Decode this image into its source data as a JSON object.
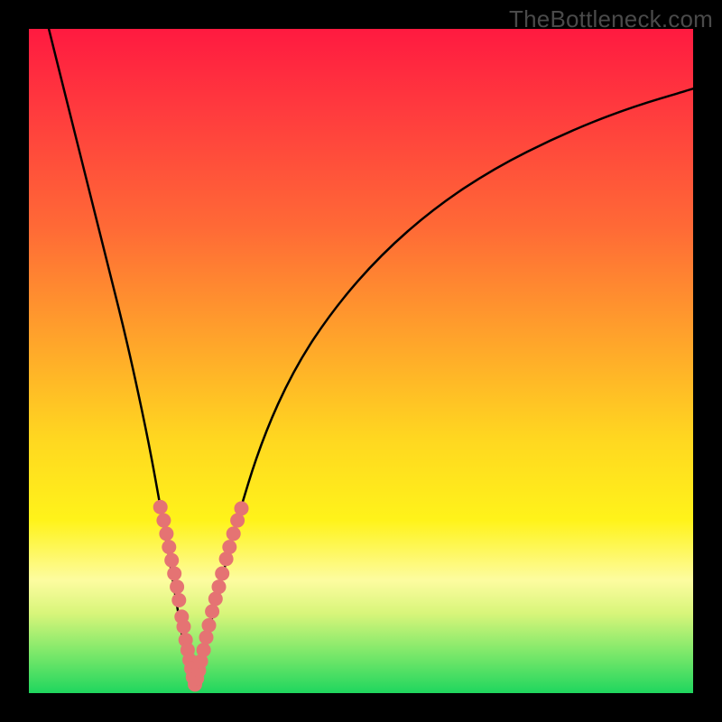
{
  "watermark": "TheBottleneck.com",
  "colors": {
    "frame": "#000000",
    "gradient_top": "#ff1a40",
    "gradient_mid1": "#ff6a36",
    "gradient_mid2": "#ffd820",
    "gradient_mid3": "#fdfca0",
    "gradient_bottom": "#1fd65e",
    "curve": "#000000",
    "marker": "#e57373"
  },
  "chart_data": {
    "type": "line",
    "title": "",
    "xlabel": "",
    "ylabel": "",
    "xlim": [
      0,
      100
    ],
    "ylim": [
      0,
      100
    ],
    "series": [
      {
        "name": "bottleneck-curve",
        "x": [
          3,
          6,
          9,
          12,
          15,
          18,
          20,
          22,
          23.5,
          25,
          26,
          28,
          31,
          35,
          40,
          46,
          53,
          61,
          70,
          80,
          90,
          100
        ],
        "y": [
          100,
          88,
          76,
          64,
          52,
          38,
          27,
          15,
          6,
          0,
          5,
          13,
          25,
          38,
          49,
          58,
          66,
          73,
          79,
          84,
          88,
          91
        ]
      }
    ],
    "markers": {
      "name": "highlighted-points",
      "note": "Dense salmon markers clustered near the V dip on both branches (approx y in 3–27 range).",
      "points": [
        {
          "x": 19.8,
          "y": 28
        },
        {
          "x": 20.3,
          "y": 26
        },
        {
          "x": 20.7,
          "y": 24
        },
        {
          "x": 21.1,
          "y": 22
        },
        {
          "x": 21.5,
          "y": 20
        },
        {
          "x": 21.9,
          "y": 18
        },
        {
          "x": 22.3,
          "y": 16
        },
        {
          "x": 22.6,
          "y": 14
        },
        {
          "x": 23.0,
          "y": 11.5
        },
        {
          "x": 23.3,
          "y": 10
        },
        {
          "x": 23.6,
          "y": 8
        },
        {
          "x": 23.9,
          "y": 6.5
        },
        {
          "x": 24.2,
          "y": 5
        },
        {
          "x": 24.45,
          "y": 3.7
        },
        {
          "x": 24.7,
          "y": 2.4
        },
        {
          "x": 25.0,
          "y": 1.3
        },
        {
          "x": 25.3,
          "y": 2.2
        },
        {
          "x": 25.6,
          "y": 3.4
        },
        {
          "x": 25.9,
          "y": 4.8
        },
        {
          "x": 26.3,
          "y": 6.5
        },
        {
          "x": 26.7,
          "y": 8.4
        },
        {
          "x": 27.1,
          "y": 10.2
        },
        {
          "x": 27.6,
          "y": 12.3
        },
        {
          "x": 28.1,
          "y": 14.2
        },
        {
          "x": 28.6,
          "y": 16.0
        },
        {
          "x": 29.1,
          "y": 18.0
        },
        {
          "x": 29.7,
          "y": 20.2
        },
        {
          "x": 30.2,
          "y": 22.0
        },
        {
          "x": 30.8,
          "y": 24.0
        },
        {
          "x": 31.4,
          "y": 26.0
        },
        {
          "x": 32.0,
          "y": 27.8
        }
      ]
    }
  }
}
